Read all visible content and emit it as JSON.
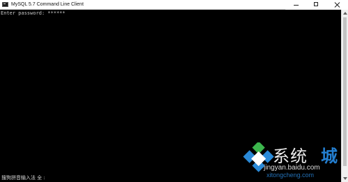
{
  "window": {
    "title": "MySQL 5.7 Command Line Client",
    "icon": "console-icon"
  },
  "controls": {
    "minimize_icon": "minimize-icon",
    "maximize_icon": "maximize-icon",
    "close_icon": "close-icon"
  },
  "console": {
    "line1": "Enter password: ******"
  },
  "ime": {
    "status": "搜狗拼音输入法 全 :"
  },
  "watermark": {
    "mark": "系统",
    "accent": "城",
    "site1": "jingyan.baidu.com",
    "site2": "xitongcheng.com"
  },
  "colors": {
    "console_background": "#000000",
    "console_text": "#c9c9c9",
    "titlebar_background": "#ffffff",
    "watermark_blue": "#247fd1",
    "watermark_green": "#3cb64d"
  }
}
